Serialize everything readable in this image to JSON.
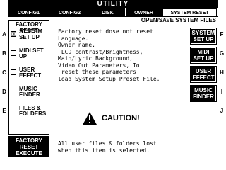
{
  "title": "UTILITY",
  "tabs": [
    "CONFIG1",
    "CONFIG2",
    "DISK",
    "OWNER",
    "SYSTEM RESET"
  ],
  "page_heading": "OPEN/SAVE SYSTEM FILES",
  "left_letters": [
    "A",
    "B",
    "C",
    "D",
    "E"
  ],
  "right_letters": [
    "F",
    "G",
    "H",
    "I",
    "J"
  ],
  "factory_reset": {
    "title": "FACTORY RESET",
    "options": [
      {
        "label": "SYSTEM SET UP",
        "checked": "☒"
      },
      {
        "label": "MIDI SET UP",
        "checked": ""
      },
      {
        "label": "USER EFFECT",
        "checked": ""
      },
      {
        "label": "MUSIC FINDER",
        "checked": ""
      },
      {
        "label": "FILES & FOLDERS",
        "checked": ""
      }
    ],
    "execute_label": "FACTORY RESET EXECUTE"
  },
  "description": "Factory reset dose not reset\nLanguage.\nOwner name,\n LCD contrast/Brightness,\nMain/Lyric Background,\nVideo Out Parameters, To\n reset these parameters\nload System Setup Preset File.",
  "right_buttons": [
    "SYSTEM SET UP",
    "MIDI SET UP",
    "USER EFFECT",
    "MUSIC FINDER"
  ],
  "caution": "CAUTION!",
  "warning": "All user files & folders lost\nwhen this item is selected."
}
